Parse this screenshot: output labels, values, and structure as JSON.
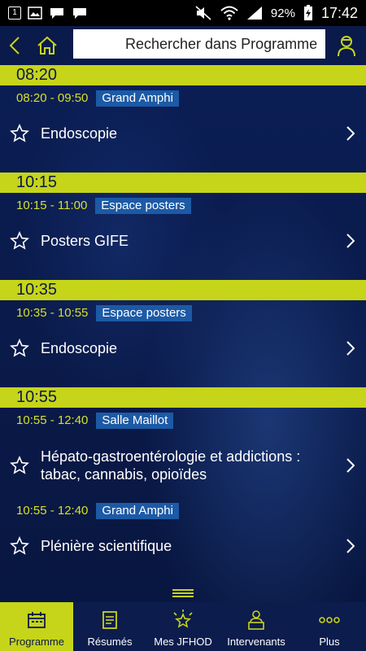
{
  "status_bar": {
    "notification_count": "1",
    "battery": "92%",
    "time": "17:42"
  },
  "header": {
    "search_placeholder": "Rechercher dans Programme"
  },
  "slots": [
    {
      "header": "08:20",
      "sessions": [
        {
          "time": "08:20 - 09:50",
          "room": "Grand Amphi",
          "title": "Endoscopie"
        }
      ]
    },
    {
      "header": "10:15",
      "sessions": [
        {
          "time": "10:15 - 11:00",
          "room": "Espace posters",
          "title": "Posters GIFE"
        }
      ]
    },
    {
      "header": "10:35",
      "sessions": [
        {
          "time": "10:35 - 10:55",
          "room": "Espace posters",
          "title": "Endoscopie"
        }
      ]
    },
    {
      "header": "10:55",
      "sessions": [
        {
          "time": "10:55 - 12:40",
          "room": "Salle Maillot",
          "title": "Hépato-gastroentérologie et addictions : tabac, cannabis, opioïdes"
        },
        {
          "time": "10:55 - 12:40",
          "room": "Grand Amphi",
          "title": "Plénière scientifique"
        }
      ]
    }
  ],
  "nav": [
    {
      "label": "Programme",
      "icon": "calendar-icon",
      "active": true
    },
    {
      "label": "Résumés",
      "icon": "document-icon"
    },
    {
      "label": "Mes JFHOD",
      "icon": "star-burst-icon"
    },
    {
      "label": "Intervenants",
      "icon": "speaker-icon"
    },
    {
      "label": "Plus",
      "icon": "more-icon"
    }
  ],
  "colors": {
    "background": "#0a1a4a",
    "accent": "#c6d41a",
    "time_text": "#d5e02a",
    "room_tag": "#1c5aa6"
  }
}
